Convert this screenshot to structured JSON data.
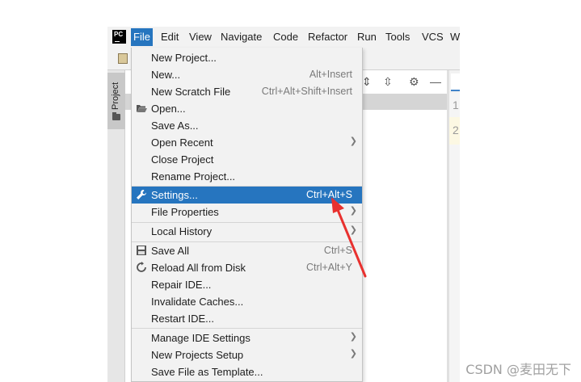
{
  "app": {
    "logo_text": "PC"
  },
  "menubar": {
    "items": [
      "File",
      "Edit",
      "View",
      "Navigate",
      "Code",
      "Refactor",
      "Run",
      "Tools",
      "VCS",
      "W"
    ],
    "active": "File"
  },
  "sidebar": {
    "project_tab_label": "Project"
  },
  "gutter": {
    "line_numbers": [
      "1",
      "2"
    ]
  },
  "file_menu": {
    "items": [
      {
        "label": "New Project...",
        "shortcut": ""
      },
      {
        "label": "New...",
        "shortcut": "Alt+Insert"
      },
      {
        "label": "New Scratch File",
        "shortcut": "Ctrl+Alt+Shift+Insert"
      },
      {
        "label": "Open...",
        "shortcut": "",
        "icon": "folder-open-icon"
      },
      {
        "label": "Save As...",
        "shortcut": ""
      },
      {
        "label": "Open Recent",
        "shortcut": "",
        "submenu": true
      },
      {
        "label": "Close Project",
        "shortcut": ""
      },
      {
        "label": "Rename Project...",
        "shortcut": ""
      },
      {
        "label": "Settings...",
        "shortcut": "Ctrl+Alt+S",
        "icon": "wrench-icon",
        "highlighted": true
      },
      {
        "label": "File Properties",
        "shortcut": "",
        "submenu": true
      },
      {
        "label": "Local History",
        "shortcut": "",
        "submenu": true
      },
      {
        "label": "Save All",
        "shortcut": "Ctrl+S",
        "icon": "save-icon"
      },
      {
        "label": "Reload All from Disk",
        "shortcut": "Ctrl+Alt+Y",
        "icon": "reload-icon"
      },
      {
        "label": "Repair IDE...",
        "shortcut": ""
      },
      {
        "label": "Invalidate Caches...",
        "shortcut": ""
      },
      {
        "label": "Restart IDE...",
        "shortcut": ""
      },
      {
        "label": "Manage IDE Settings",
        "shortcut": "",
        "submenu": true
      },
      {
        "label": "New Projects Setup",
        "shortcut": "",
        "submenu": true
      },
      {
        "label": "Save File as Template...",
        "shortcut": ""
      }
    ]
  },
  "annotation": {
    "arrow_color": "#e8312f"
  },
  "watermark": {
    "text": "CSDN @麦田无下"
  },
  "colors": {
    "menu_highlight": "#2675bf",
    "menu_background": "#f2f2f2"
  }
}
